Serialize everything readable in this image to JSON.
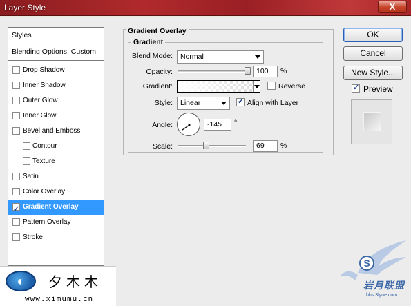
{
  "window": {
    "title": "Layer Style",
    "close_label": "X"
  },
  "styles_panel": {
    "header": "Styles",
    "blending_options": "Blending Options: Custom",
    "items": [
      {
        "label": "Drop Shadow",
        "checked": false,
        "selected": false,
        "indent": false
      },
      {
        "label": "Inner Shadow",
        "checked": false,
        "selected": false,
        "indent": false
      },
      {
        "label": "Outer Glow",
        "checked": false,
        "selected": false,
        "indent": false
      },
      {
        "label": "Inner Glow",
        "checked": false,
        "selected": false,
        "indent": false
      },
      {
        "label": "Bevel and Emboss",
        "checked": false,
        "selected": false,
        "indent": false
      },
      {
        "label": "Contour",
        "checked": false,
        "selected": false,
        "indent": true
      },
      {
        "label": "Texture",
        "checked": false,
        "selected": false,
        "indent": true
      },
      {
        "label": "Satin",
        "checked": false,
        "selected": false,
        "indent": false
      },
      {
        "label": "Color Overlay",
        "checked": false,
        "selected": false,
        "indent": false
      },
      {
        "label": "Gradient Overlay",
        "checked": true,
        "selected": true,
        "indent": false
      },
      {
        "label": "Pattern Overlay",
        "checked": false,
        "selected": false,
        "indent": false
      },
      {
        "label": "Stroke",
        "checked": false,
        "selected": false,
        "indent": false
      }
    ]
  },
  "gradient_overlay": {
    "section_title": "Gradient Overlay",
    "group_title": "Gradient",
    "blend_mode": {
      "label": "Blend Mode:",
      "value": "Normal"
    },
    "opacity": {
      "label": "Opacity:",
      "value": "100",
      "unit": "%",
      "level_percent": 100
    },
    "gradient": {
      "label": "Gradient:",
      "reverse_label": "Reverse",
      "reverse_checked": false
    },
    "style": {
      "label": "Style:",
      "value": "Linear",
      "align_label": "Align with Layer",
      "align_checked": true
    },
    "angle": {
      "label": "Angle:",
      "value": "-145",
      "unit": "°",
      "degrees": -145
    },
    "scale": {
      "label": "Scale:",
      "value": "69",
      "unit": "%",
      "level_percent": 69
    }
  },
  "buttons": {
    "ok": "OK",
    "cancel": "Cancel",
    "new_style": "New Style...",
    "preview_label": "Preview",
    "preview_checked": true
  },
  "watermarks": {
    "left_brand": "夕木木",
    "left_url": "www.ximumu.cn",
    "right_brand": "岩月联盟",
    "right_url": "bbs.3lyue.com",
    "right_logo_letter": "S"
  },
  "colors": {
    "selection": "#3199ff",
    "title_bar": "#a82628",
    "default_button_border": "#2b5fb5"
  }
}
